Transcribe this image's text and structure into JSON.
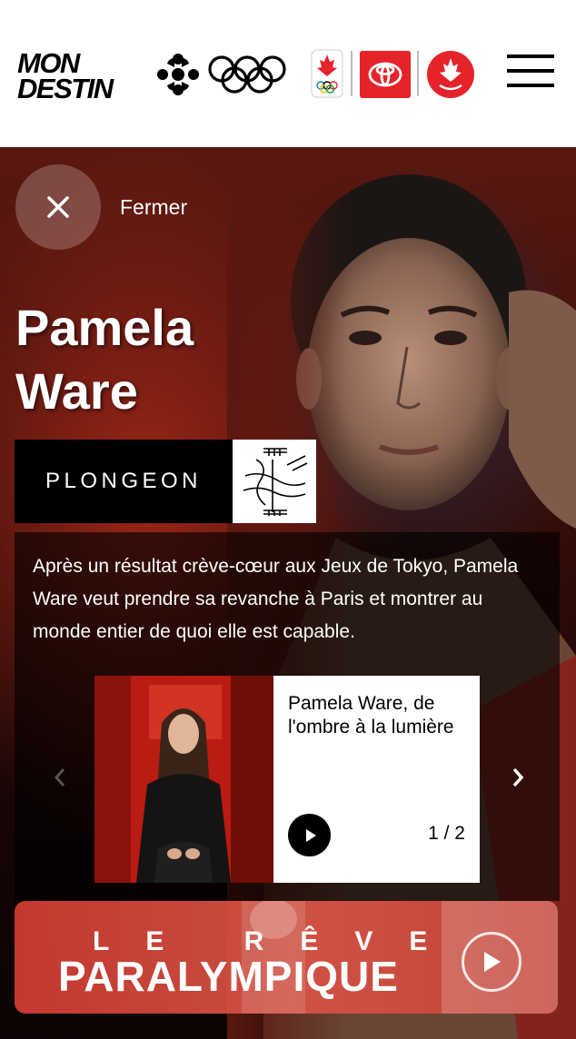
{
  "header": {
    "logo_line1": "MON",
    "logo_line2": "DESTIN"
  },
  "hero": {
    "close_label": "Fermer",
    "name_first": "Pamela",
    "name_last": "Ware",
    "sport": "PLONGEON",
    "description": "Après un résultat crève-cœur aux Jeux de Tokyo, Pamela Ware veut prendre sa revanche à Paris et montrer au monde entier de quoi elle est capable."
  },
  "carousel": {
    "video_title": "Pamela Ware, de l'ombre à la lumière",
    "counter": "1 / 2"
  },
  "banner": {
    "line1": "LE RÊVE",
    "line2": "PARALYMPIQUE"
  },
  "colors": {
    "accent_red": "#e4232a",
    "hero_red": "#9b2618"
  }
}
